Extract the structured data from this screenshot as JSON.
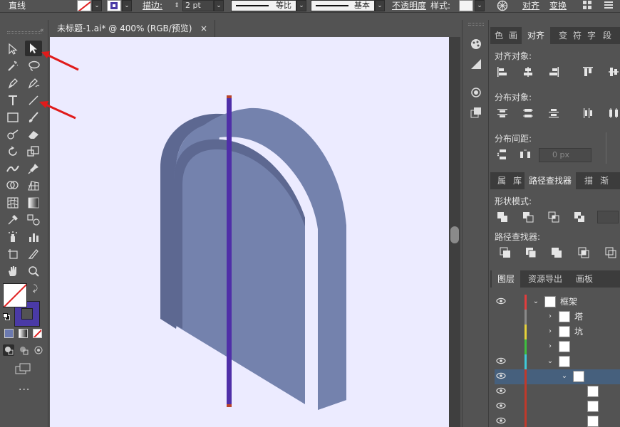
{
  "control_bar": {
    "object_type": "直线",
    "stroke_label": "描边:",
    "stroke_weight": "2 pt",
    "profile_label": "等比",
    "brush_label": "基本",
    "opacity_label": "不透明度",
    "style_label": "样式:",
    "align_label": "对齐",
    "transform_label": "变换"
  },
  "document": {
    "tab_title": "未标题-1.ai* @ 400% (RGB/预览)",
    "close_glyph": "×"
  },
  "colors": {
    "fill_none": "#ffffff",
    "stroke_color": "#4a3aa6",
    "canvas_bg": "#ecebff",
    "arch_front": "#7482ad",
    "arch_side": "#5d6891",
    "line_color": "#4f2fa8",
    "line_ends": "#b8422a",
    "annotation_arrow": "#e01b1b"
  },
  "right_panel": {
    "tabs_top": [
      "色",
      "画",
      "对齐",
      "变",
      "符",
      "字",
      "段"
    ],
    "align_objects_label": "对齐对象:",
    "distribute_objects_label": "分布对象:",
    "distribute_spacing_label": "分布间距:",
    "spacing_value": "0 px",
    "tabs_mid": [
      "属",
      "库",
      "路径查找器",
      "描",
      "渐"
    ],
    "shape_modes_label": "形状模式:",
    "pathfinders_label": "路径查找器:",
    "tabs_layers": [
      "图层",
      "资源导出",
      "画板"
    ]
  },
  "layers": [
    {
      "name": "框架",
      "color": "#e23d3d",
      "eye": true,
      "chevron": "⌄",
      "indent": 0
    },
    {
      "name": "塔",
      "color": "#8a8a8a",
      "eye": false,
      "chevron": "›",
      "indent": 1
    },
    {
      "name": "坑",
      "color": "#e6d23a",
      "eye": false,
      "chevron": "›",
      "indent": 1
    },
    {
      "name": "",
      "color": "#3fbf3f",
      "eye": false,
      "chevron": "›",
      "indent": 1
    },
    {
      "name": "",
      "color": "#3fc9d9",
      "eye": true,
      "chevron": "⌄",
      "indent": 1
    },
    {
      "name": "",
      "color": "#c0392b",
      "eye": true,
      "chevron": "⌄",
      "indent": 2
    },
    {
      "name": "",
      "color": "#c0392b",
      "eye": true,
      "chevron": "",
      "indent": 3
    },
    {
      "name": "",
      "color": "#c0392b",
      "eye": true,
      "chevron": "",
      "indent": 3
    },
    {
      "name": "",
      "color": "#c0392b",
      "eye": true,
      "chevron": "",
      "indent": 3
    }
  ]
}
